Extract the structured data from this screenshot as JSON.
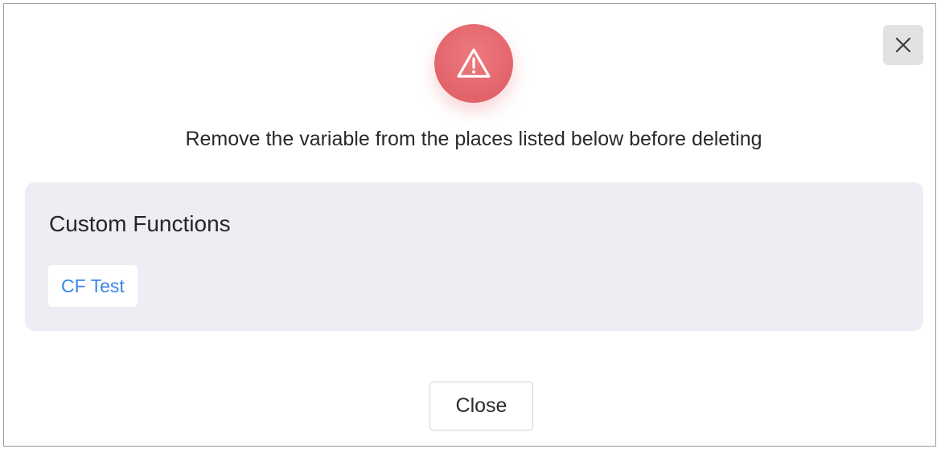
{
  "dialog": {
    "icons": {
      "close": "close-icon",
      "warning": "warning-triangle-icon"
    },
    "message": "Remove the variable from the places listed below before deleting",
    "usage_section": {
      "heading": "Custom Functions",
      "items": [
        {
          "label": "CF Test"
        }
      ]
    },
    "close_button_label": "Close"
  },
  "colors": {
    "warning_accent": "#e2636a",
    "link": "#3a86e8",
    "panel_background": "#eceef3"
  }
}
